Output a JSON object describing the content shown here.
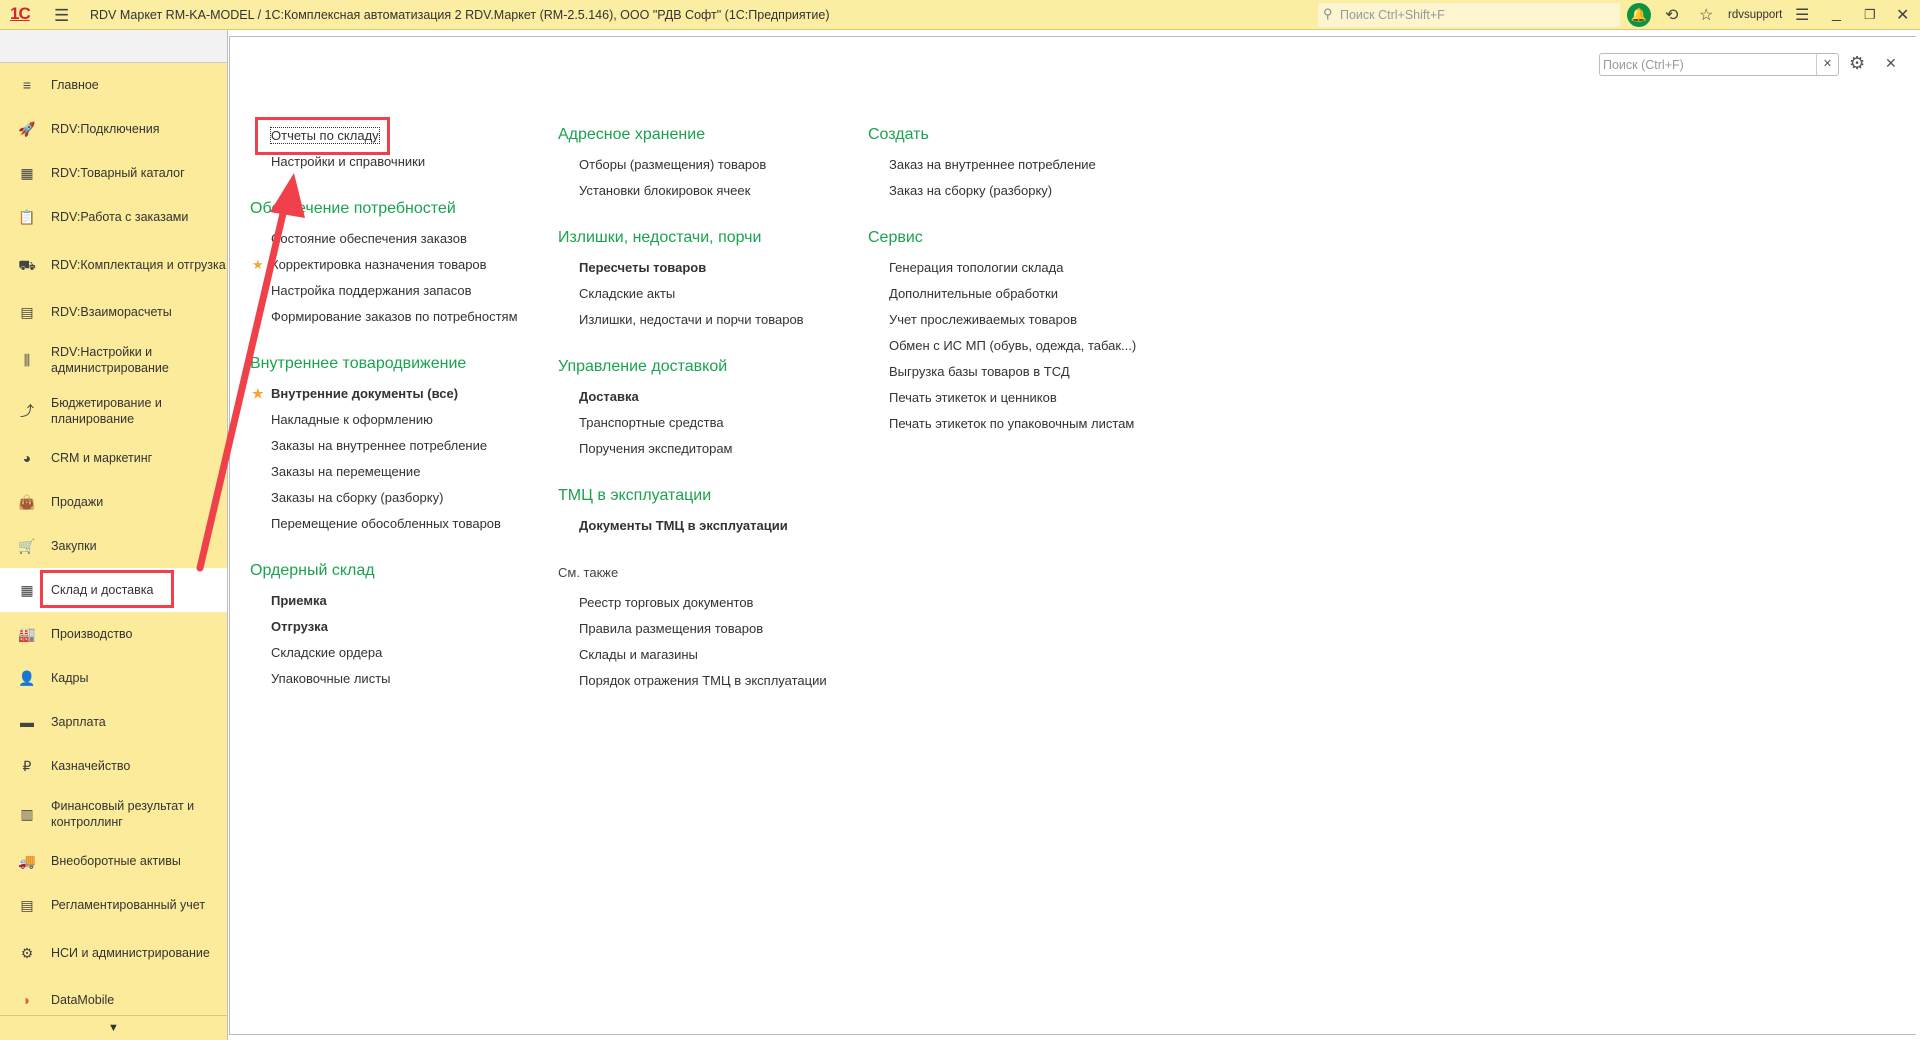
{
  "titlebar": {
    "logo": "1С",
    "title": "RDV Маркет RM-KA-MODEL / 1С:Комплексная автоматизация 2 RDV.Маркет (RM-2.5.146), ООО \"РДВ Софт\"  (1С:Предприятие)",
    "search_placeholder": "Поиск Ctrl+Shift+F",
    "user": "rdvsupport"
  },
  "sidebar": {
    "items": [
      {
        "label": "Главное",
        "icon": "≡",
        "name": "menu"
      },
      {
        "label": "RDV:Подключения",
        "icon": "🚀",
        "name": "rocket"
      },
      {
        "label": "RDV:Товарный каталог",
        "icon": "▦",
        "name": "catalog"
      },
      {
        "label": "RDV:Работа с заказами",
        "icon": "📋",
        "name": "orders"
      },
      {
        "label": "RDV:Комплектация и отгрузка",
        "icon": "⛟",
        "name": "cart-box",
        "two": true
      },
      {
        "label": "RDV:Взаиморасчеты",
        "icon": "▤",
        "name": "calculator"
      },
      {
        "label": "RDV:Настройки и администрирование",
        "icon": "⫼",
        "name": "sliders",
        "two": true
      },
      {
        "label": "Бюджетирование и планирование",
        "icon": "⤴",
        "name": "budget-chart",
        "two": true
      },
      {
        "label": "CRM и маркетинг",
        "icon": "◕",
        "name": "pie-chart"
      },
      {
        "label": "Продажи",
        "icon": "👜",
        "name": "bag"
      },
      {
        "label": "Закупки",
        "icon": "🛒",
        "name": "cart"
      },
      {
        "label": "Склад и доставка",
        "icon": "▦",
        "name": "warehouse",
        "active": true
      },
      {
        "label": "Производство",
        "icon": "🏭",
        "name": "factory"
      },
      {
        "label": "Кадры",
        "icon": "👤",
        "name": "person"
      },
      {
        "label": "Зарплата",
        "icon": "▬",
        "name": "card"
      },
      {
        "label": "Казначейство",
        "icon": "₽",
        "name": "ruble"
      },
      {
        "label": "Финансовый результат и контроллинг",
        "icon": "▥",
        "name": "bar-chart",
        "two": true
      },
      {
        "label": "Внеоборотные активы",
        "icon": "🚚",
        "name": "truck"
      },
      {
        "label": "Регламентированный учет",
        "icon": "▤",
        "name": "reg-calculator"
      },
      {
        "label": "НСИ и администрирование",
        "icon": "⚙",
        "name": "gear",
        "two": true
      },
      {
        "label": "DataMobile",
        "icon": "◗",
        "name": "datamobile"
      }
    ]
  },
  "panel": {
    "search_placeholder": "Поиск (Ctrl+F)"
  },
  "columns": [
    [
      {
        "heading": "",
        "items": [
          {
            "label": "Отчеты по складу",
            "focus": true
          },
          {
            "label": "Настройки и справочники"
          }
        ]
      },
      {
        "heading": "Обеспечение потребностей",
        "items": [
          {
            "label": "Состояние обеспечения заказов"
          },
          {
            "label": "Корректировка назначения товаров",
            "star": true
          },
          {
            "label": "Настройка поддержания запасов"
          },
          {
            "label": "Формирование заказов по потребностям"
          }
        ]
      },
      {
        "heading": "Внутреннее товародвижение",
        "items": [
          {
            "label": "Внутренние документы (все)",
            "star": true,
            "bold": true
          },
          {
            "label": "Накладные к оформлению"
          },
          {
            "label": "Заказы на внутреннее потребление"
          },
          {
            "label": "Заказы на перемещение"
          },
          {
            "label": "Заказы на сборку (разборку)"
          },
          {
            "label": "Перемещение обособленных товаров"
          }
        ]
      },
      {
        "heading": "Ордерный склад",
        "items": [
          {
            "label": "Приемка",
            "bold": true
          },
          {
            "label": "Отгрузка",
            "bold": true
          },
          {
            "label": "Складские ордера"
          },
          {
            "label": "Упаковочные листы"
          }
        ]
      }
    ],
    [
      {
        "heading": "Адресное хранение",
        "items": [
          {
            "label": "Отборы (размещения) товаров"
          },
          {
            "label": "Установки блокировок ячеек"
          }
        ]
      },
      {
        "heading": "Излишки, недостачи, порчи",
        "items": [
          {
            "label": "Пересчеты товаров",
            "bold": true
          },
          {
            "label": "Складские акты"
          },
          {
            "label": "Излишки, недостачи и порчи товаров"
          }
        ]
      },
      {
        "heading": "Управление доставкой",
        "items": [
          {
            "label": "Доставка",
            "bold": true
          },
          {
            "label": "Транспортные средства"
          },
          {
            "label": "Поручения экспедиторам"
          }
        ]
      },
      {
        "heading": "ТМЦ в эксплуатации",
        "items": [
          {
            "label": "Документы ТМЦ в эксплуатации",
            "bold": true
          }
        ]
      },
      {
        "heading": "См. также",
        "gray": true,
        "items": [
          {
            "label": "Реестр торговых документов"
          },
          {
            "label": "Правила размещения товаров"
          },
          {
            "label": "Склады и магазины"
          },
          {
            "label": "Порядок отражения ТМЦ в эксплуатации"
          }
        ]
      }
    ],
    [
      {
        "heading": "Создать",
        "items": [
          {
            "label": "Заказ на внутреннее потребление"
          },
          {
            "label": "Заказ на сборку (разборку)"
          }
        ]
      },
      {
        "heading": "Сервис",
        "items": [
          {
            "label": "Генерация топологии склада"
          },
          {
            "label": "Дополнительные обработки"
          },
          {
            "label": "Учет прослеживаемых товаров"
          },
          {
            "label": "Обмен с ИС МП (обувь, одежда, табак...)"
          },
          {
            "label": "Выгрузка базы товаров в ТСД"
          },
          {
            "label": "Печать этикеток и ценников"
          },
          {
            "label": "Печать этикеток по упаковочным листам"
          }
        ]
      }
    ]
  ],
  "colors": {
    "accent_green": "#1aa34f",
    "annotation_red": "#f0404a",
    "sidebar_bg": "#fbeb9b"
  }
}
